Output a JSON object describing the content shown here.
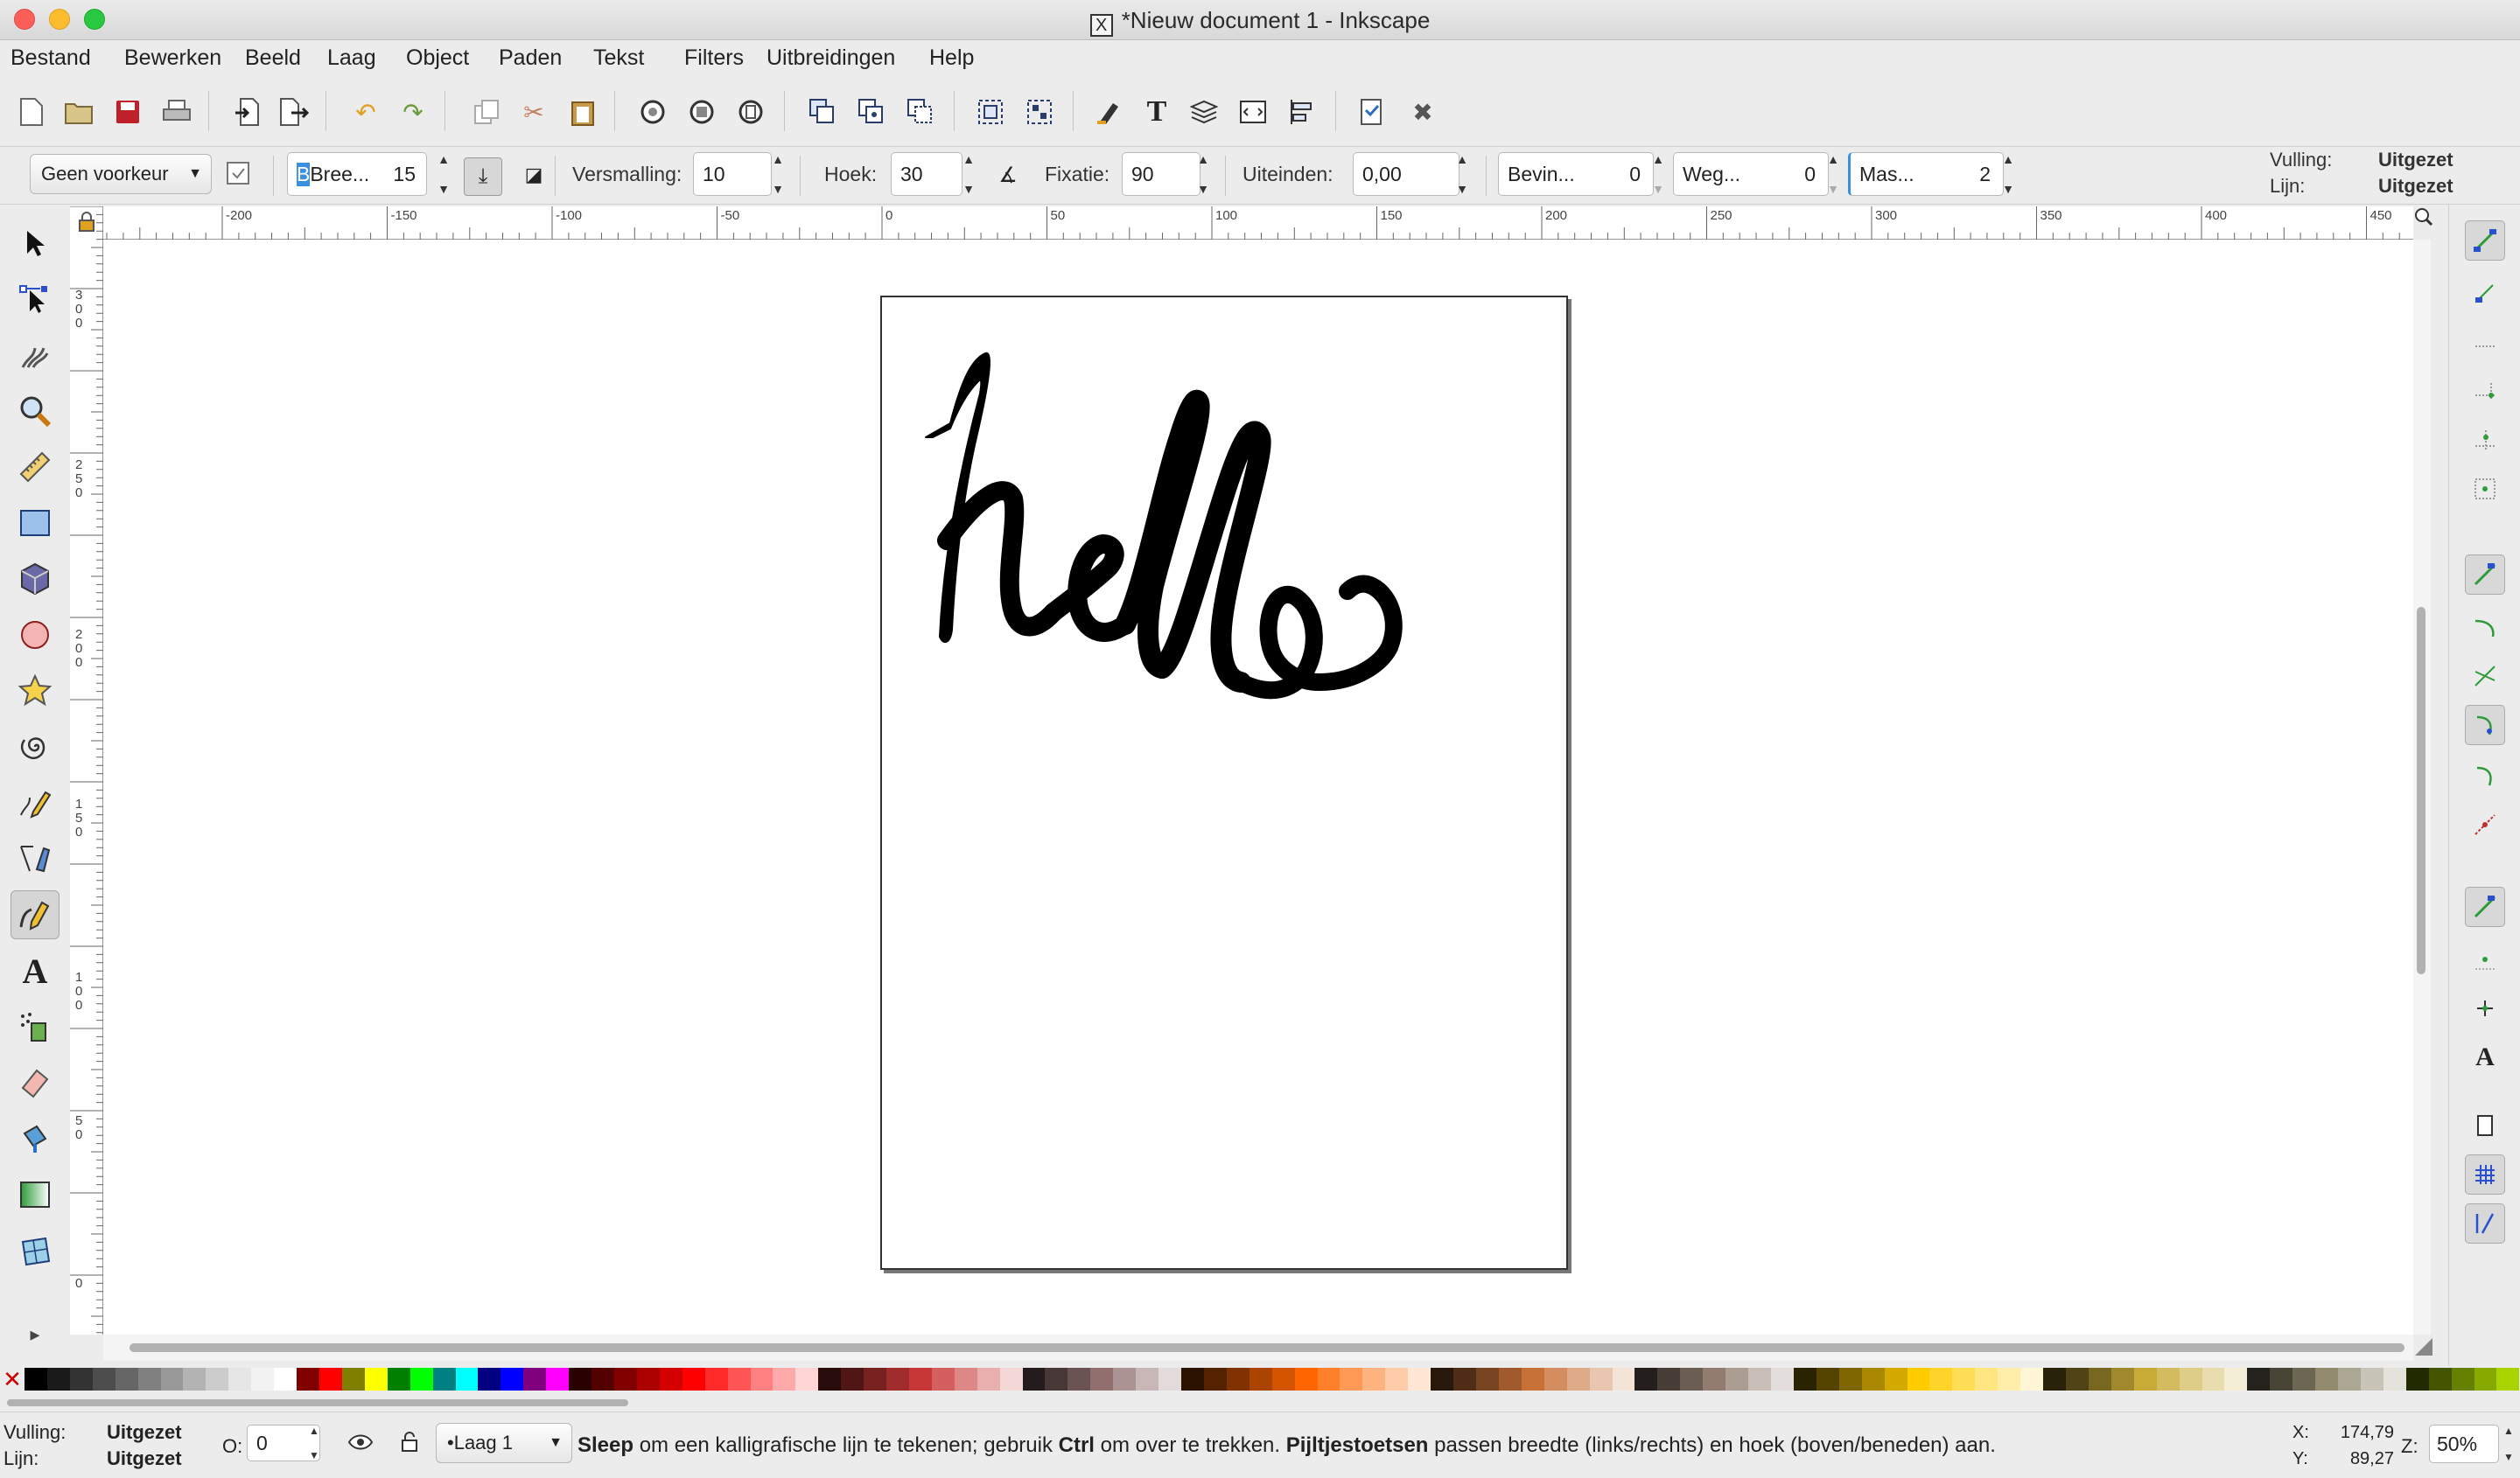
{
  "window": {
    "title": "*Nieuw document 1 - Inkscape",
    "x_icon": "X"
  },
  "menu": [
    "Bestand",
    "Bewerken",
    "Beeld",
    "Laag",
    "Object",
    "Paden",
    "Tekst",
    "Filters",
    "Uitbreidingen",
    "Help"
  ],
  "tool_controls": {
    "preset": "Geen voorkeur",
    "width_label": "Bree...",
    "width_value": "15",
    "thinning_label": "Versmalling:",
    "thinning_value": "10",
    "angle_label": "Hoek:",
    "angle_value": "30",
    "fixation_label": "Fixatie:",
    "fixation_value": "90",
    "caps_label": "Uiteinden:",
    "caps_value": "0,00",
    "tremor_label": "Bevin...",
    "tremor_value": "0",
    "wiggle_label": "Weg...",
    "wiggle_value": "0",
    "mass_label": "Mas...",
    "mass_value": "2"
  },
  "style_indicator": {
    "fill_label": "Vulling:",
    "fill_value": "Uitgezet",
    "stroke_label": "Lijn:",
    "stroke_value": "Uitgezet"
  },
  "ruler_top_ticks": [
    "-200",
    "-150",
    "-100",
    "-50",
    "0",
    "50",
    "100",
    "150",
    "200",
    "250",
    "300",
    "350",
    "400",
    "450"
  ],
  "ruler_left_ticks": [
    "3\n0\n0",
    "2\n5\n0",
    "2\n0\n0",
    "1\n5\n0",
    "1\n0\n0",
    "5\n0",
    "0"
  ],
  "canvas": {
    "drawing_text": "hello"
  },
  "status": {
    "fill_label": "Vulling:",
    "fill_value": "Uitgezet",
    "stroke_label": "Lijn:",
    "stroke_value": "Uitgezet",
    "opacity_label": "O:",
    "opacity_value": "0",
    "layer": "•Laag 1",
    "message_parts": [
      {
        "t": "Sleep",
        "b": true
      },
      {
        "t": " om een kalligrafische lijn te tekenen; gebruik ",
        "b": false
      },
      {
        "t": "Ctrl",
        "b": true
      },
      {
        "t": " om over te trekken. ",
        "b": false
      },
      {
        "t": "Pijltjestoetsen",
        "b": true
      },
      {
        "t": " passen breedte (links/rechts) en hoek (boven/beneden) aan.",
        "b": false
      }
    ],
    "x_label": "X:",
    "x_value": "174,79",
    "y_label": "Y:",
    "y_value": "89,27",
    "zoom_label": "Z:",
    "zoom_value": "50%"
  },
  "palette_colors": [
    "#000000",
    "#1a1a1a",
    "#333333",
    "#4d4d4d",
    "#666666",
    "#808080",
    "#999999",
    "#b3b3b3",
    "#cccccc",
    "#e6e6e6",
    "#f2f2f2",
    "#ffffff",
    "#800000",
    "#ff0000",
    "#808000",
    "#ffff00",
    "#008000",
    "#00ff00",
    "#008080",
    "#00ffff",
    "#000080",
    "#0000ff",
    "#800080",
    "#ff00ff",
    "#2b0000",
    "#550000",
    "#800000",
    "#aa0000",
    "#d40000",
    "#ff0000",
    "#ff2a2a",
    "#ff5555",
    "#ff8080",
    "#ffaaaa",
    "#ffd5d5",
    "#280b0b",
    "#501616",
    "#782121",
    "#a02c2c",
    "#c83737",
    "#d35f5f",
    "#de8787",
    "#e9afaf",
    "#f4d7d7",
    "#241c1c",
    "#483737",
    "#6c5353",
    "#916f6f",
    "#ac9393",
    "#c8b7b7",
    "#e3dbdb",
    "#2b1100",
    "#552200",
    "#803300",
    "#aa4400",
    "#d45500",
    "#ff6600",
    "#ff7f2a",
    "#ff9955",
    "#ffb380",
    "#ffccaa",
    "#ffe6d5",
    "#28170b",
    "#502d16",
    "#784421",
    "#a05a2c",
    "#c87137",
    "#d38d5f",
    "#deaa87",
    "#e9c6af",
    "#f4e3d7",
    "#241f1c",
    "#483e37",
    "#6c5d53",
    "#917c6f",
    "#ac9d93",
    "#c8beb7",
    "#e3dedb",
    "#2b2200",
    "#554400",
    "#806600",
    "#aa8800",
    "#d4aa00",
    "#ffcc00",
    "#ffd42a",
    "#ffdd55",
    "#ffe680",
    "#ffeeaa",
    "#fff6d5",
    "#28220b",
    "#504416",
    "#786721",
    "#a0892c",
    "#c8ab37",
    "#d3bc5f",
    "#decd87",
    "#e9ddaf",
    "#f4eed7",
    "#24221c",
    "#484537",
    "#6c6753",
    "#918a6f",
    "#aca793",
    "#c8c4b7",
    "#e3e2db",
    "#222b00",
    "#445500",
    "#668000",
    "#88aa00",
    "#aad400"
  ],
  "colors": {
    "accent": "#3b8fe0",
    "snap_green": "#2e9b3a",
    "snap_blue": "#2a4fcf"
  }
}
